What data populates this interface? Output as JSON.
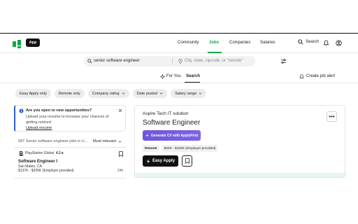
{
  "header": {
    "app_label": "App",
    "nav": [
      "Community",
      "Jobs",
      "Companies",
      "Salaries"
    ],
    "active_nav": "Jobs",
    "search_label": "Search"
  },
  "search": {
    "query": "senior software engineer",
    "location_placeholder": "City, state, zipcode, or \"remote\""
  },
  "tabs": {
    "for_you": "For You",
    "search": "Search",
    "create_alert": "Create job alert"
  },
  "filters": [
    "Easy Apply only",
    "Remote only",
    "Company rating",
    "Date posted",
    "Salary range"
  ],
  "alert_card": {
    "title": "Are you open to new opportunities?",
    "body": "Upload your resume to increase your chances of getting noticed.",
    "link": "Upload resume"
  },
  "results": {
    "count_text": "687 Senior software engineer jobs in U...",
    "sort_label": "Most relevant"
  },
  "job_list": [
    {
      "company": "PlayStation Global",
      "rating": "4.1",
      "title": "Software Engineer I",
      "location": "San Mateo, CA",
      "salary": "$137K - $205K (Employer provided)",
      "age": "24h"
    }
  ],
  "detail": {
    "company": "Aspire Tech IT solution",
    "title": "Software Engineer",
    "cv_button": "Generate CV with ApplyFirst",
    "tags": [
      "Remote",
      "$20K - $150K (Employer provided)"
    ],
    "easy_apply": "Easy Apply",
    "more": "•••"
  },
  "colors": {
    "brand_green": "#0caa41",
    "cv_purple": "#6f56d9",
    "alert_blue": "#2b5cd6"
  }
}
